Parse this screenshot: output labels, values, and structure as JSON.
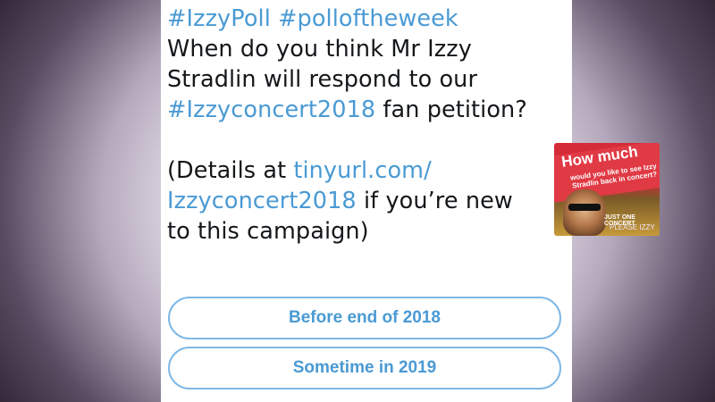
{
  "tweet": {
    "lines": [
      {
        "parts": [
          {
            "text": "#IzzyPoll #polloftheweek",
            "link": true
          }
        ]
      },
      {
        "parts": [
          {
            "text": "When do you think Mr Izzy",
            "link": false
          }
        ]
      },
      {
        "parts": [
          {
            "text": "Stradlin will respond to our",
            "link": false
          }
        ]
      },
      {
        "parts": [
          {
            "text": "#Izzyconcert2018",
            "link": true
          },
          {
            "text": " fan petition?",
            "link": false
          }
        ]
      },
      {
        "parts": []
      },
      {
        "parts": [
          {
            "text": "(Details at ",
            "link": false
          },
          {
            "text": "tinyurl.com/",
            "link": true
          }
        ]
      },
      {
        "parts": [
          {
            "text": "Izzyconcert2018",
            "link": true
          },
          {
            "text": " if you’re new",
            "link": false
          }
        ]
      },
      {
        "parts": [
          {
            "text": "to this campaign)",
            "link": false
          }
        ]
      }
    ]
  },
  "poll": {
    "options": [
      "Before end of 2018",
      "Sometime in 2019"
    ]
  },
  "thumbnail": {
    "title": "How much",
    "subtitle": "would you like to see Izzy Stradlin back in concert?",
    "tag1": "JUST ONE CONCERT",
    "tag2": "PLEASE IZZY"
  },
  "colors": {
    "link": "#4a9ad4",
    "text": "#14171a",
    "poll_border": "#7fb8e6"
  }
}
